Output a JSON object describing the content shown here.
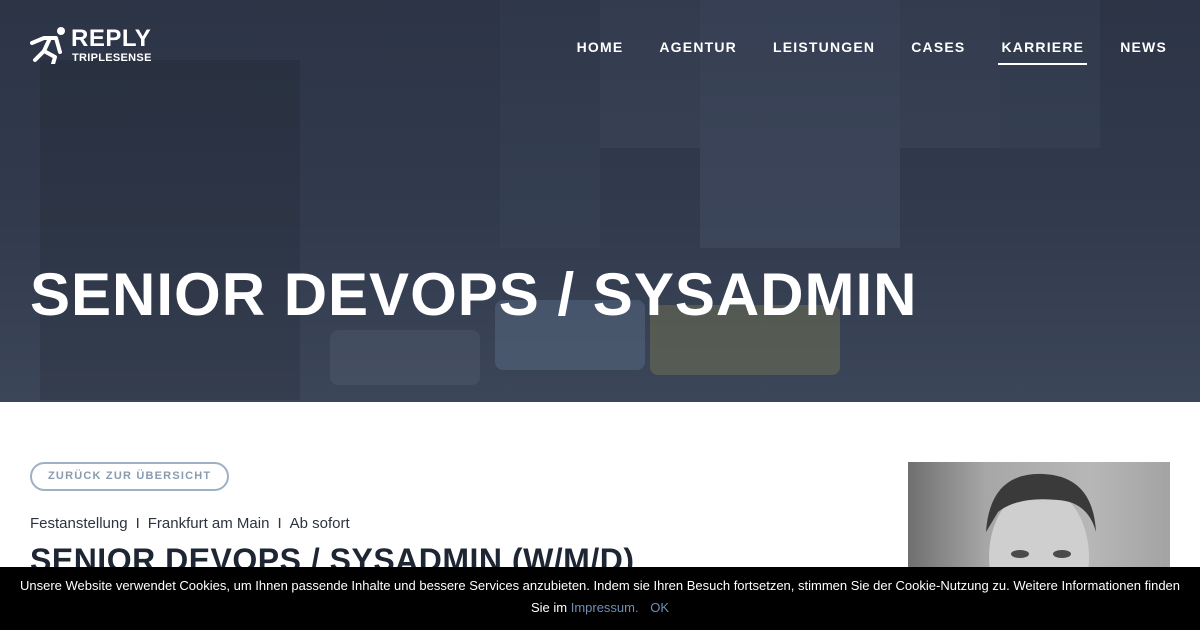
{
  "brand": {
    "name": "REPLY",
    "sub": "TRIPLESENSE"
  },
  "nav": {
    "items": [
      {
        "label": "HOME"
      },
      {
        "label": "AGENTUR"
      },
      {
        "label": "LEISTUNGEN"
      },
      {
        "label": "CASES"
      },
      {
        "label": "KARRIERE",
        "active": true
      },
      {
        "label": "NEWS"
      }
    ]
  },
  "hero": {
    "title": "SENIOR DEVOPS / SYSADMIN"
  },
  "job": {
    "back_label": "ZURÜCK ZUR ÜBERSICHT",
    "employment_type": "Festanstellung",
    "location": "Frankfurt am Main",
    "start": "Ab sofort",
    "separator": "I",
    "title": "SENIOR DEVOPS / SYSADMIN (W/M/D)"
  },
  "cookie": {
    "text_line1": "Unsere Website verwendet Cookies, um Ihnen passende Inhalte und bessere Services anzubieten. Indem sie Ihren Besuch fortsetzen, stimmen Sie der Cookie-Nutzung zu. Weitere Informationen finden",
    "text_prefix": "Sie im",
    "link_label": "Impressum.",
    "ok_label": "OK"
  },
  "colors": {
    "hero_bg": "#323b4e",
    "accent_link": "#6f8fb3",
    "pill_border": "#9fb0c3",
    "heading_dark": "#1e2633"
  }
}
